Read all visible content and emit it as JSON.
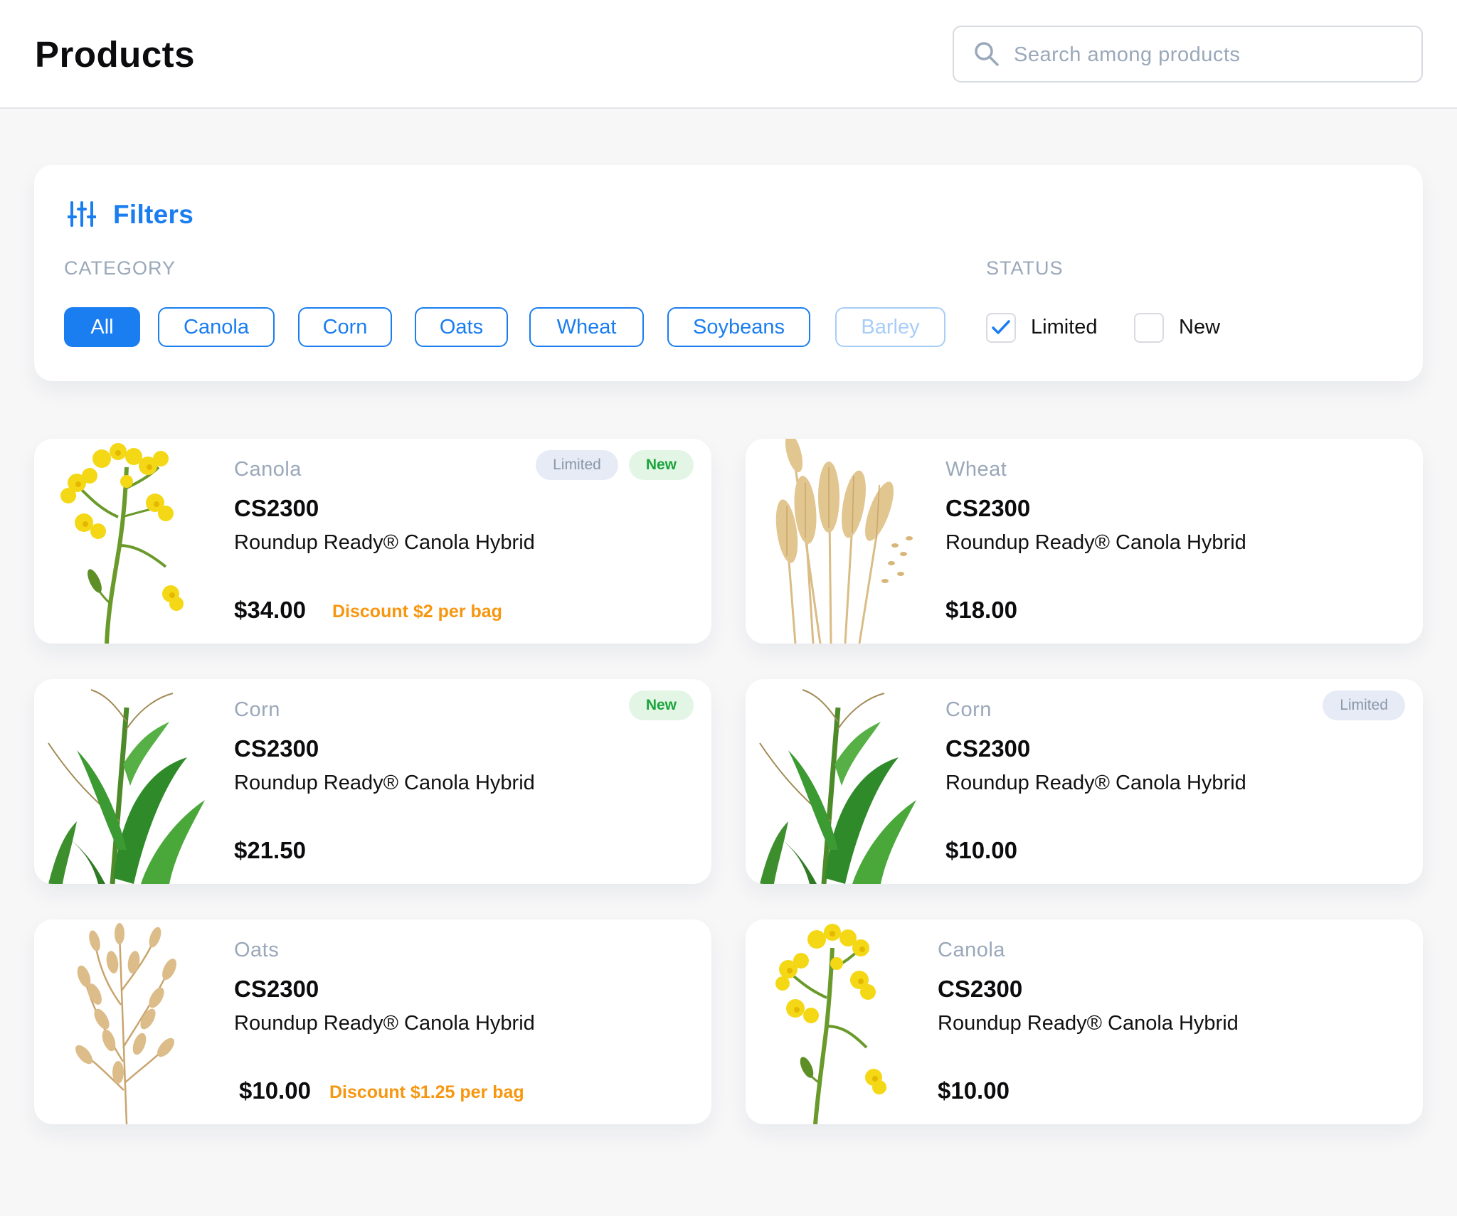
{
  "header": {
    "title": "Products",
    "search_placeholder": "Search among products"
  },
  "filters": {
    "title": "Filters",
    "category_label": "CATEGORY",
    "categories": [
      {
        "label": "All",
        "state": "active"
      },
      {
        "label": "Canola",
        "state": "default"
      },
      {
        "label": "Corn",
        "state": "default"
      },
      {
        "label": "Oats",
        "state": "default"
      },
      {
        "label": "Wheat",
        "state": "default"
      },
      {
        "label": "Soybeans",
        "state": "default"
      },
      {
        "label": "Barley",
        "state": "disabled"
      }
    ],
    "status_label": "STATUS",
    "statuses": [
      {
        "label": "Limited",
        "checked": true
      },
      {
        "label": "New",
        "checked": false
      }
    ]
  },
  "products": [
    {
      "category": "Canola",
      "code": "CS2300",
      "description": "Roundup Ready® Canola Hybrid",
      "price": "$34.00",
      "discount": "Discount $2 per bag",
      "badges": [
        "Limited",
        "New"
      ],
      "image": "canola-flower"
    },
    {
      "category": "Wheat",
      "code": "CS2300",
      "description": "Roundup Ready® Canola Hybrid",
      "price": "$18.00",
      "discount": "",
      "badges": [],
      "image": "wheat-ears"
    },
    {
      "category": "Corn",
      "code": "CS2300",
      "description": "Roundup Ready® Canola Hybrid",
      "price": "$21.50",
      "discount": "",
      "badges": [
        "New"
      ],
      "image": "corn-plant"
    },
    {
      "category": "Corn",
      "code": "CS2300",
      "description": "Roundup Ready® Canola Hybrid",
      "price": "$10.00",
      "discount": "",
      "badges": [
        "Limited"
      ],
      "image": "corn-plant"
    },
    {
      "category": "Oats",
      "code": "CS2300",
      "description": "Roundup Ready® Canola Hybrid",
      "price": "$10.00",
      "discount": "Discount $1.25 per bag",
      "badges": [],
      "image": "oat-stalks"
    },
    {
      "category": "Canola",
      "code": "CS2300",
      "description": "Roundup Ready® Canola Hybrid",
      "price": "$10.00",
      "discount": "",
      "badges": [],
      "image": "canola-flower"
    }
  ],
  "colors": {
    "accent": "#1a7df0",
    "muted_text": "#9aa8ba",
    "discount": "#f7960f",
    "badge_new_text": "#1aa43a",
    "badge_new_bg": "#e3f6e6",
    "badge_limited_text": "#8a97aa",
    "badge_limited_bg": "#e6ebf5",
    "page_bg": "#f7f7f8"
  }
}
